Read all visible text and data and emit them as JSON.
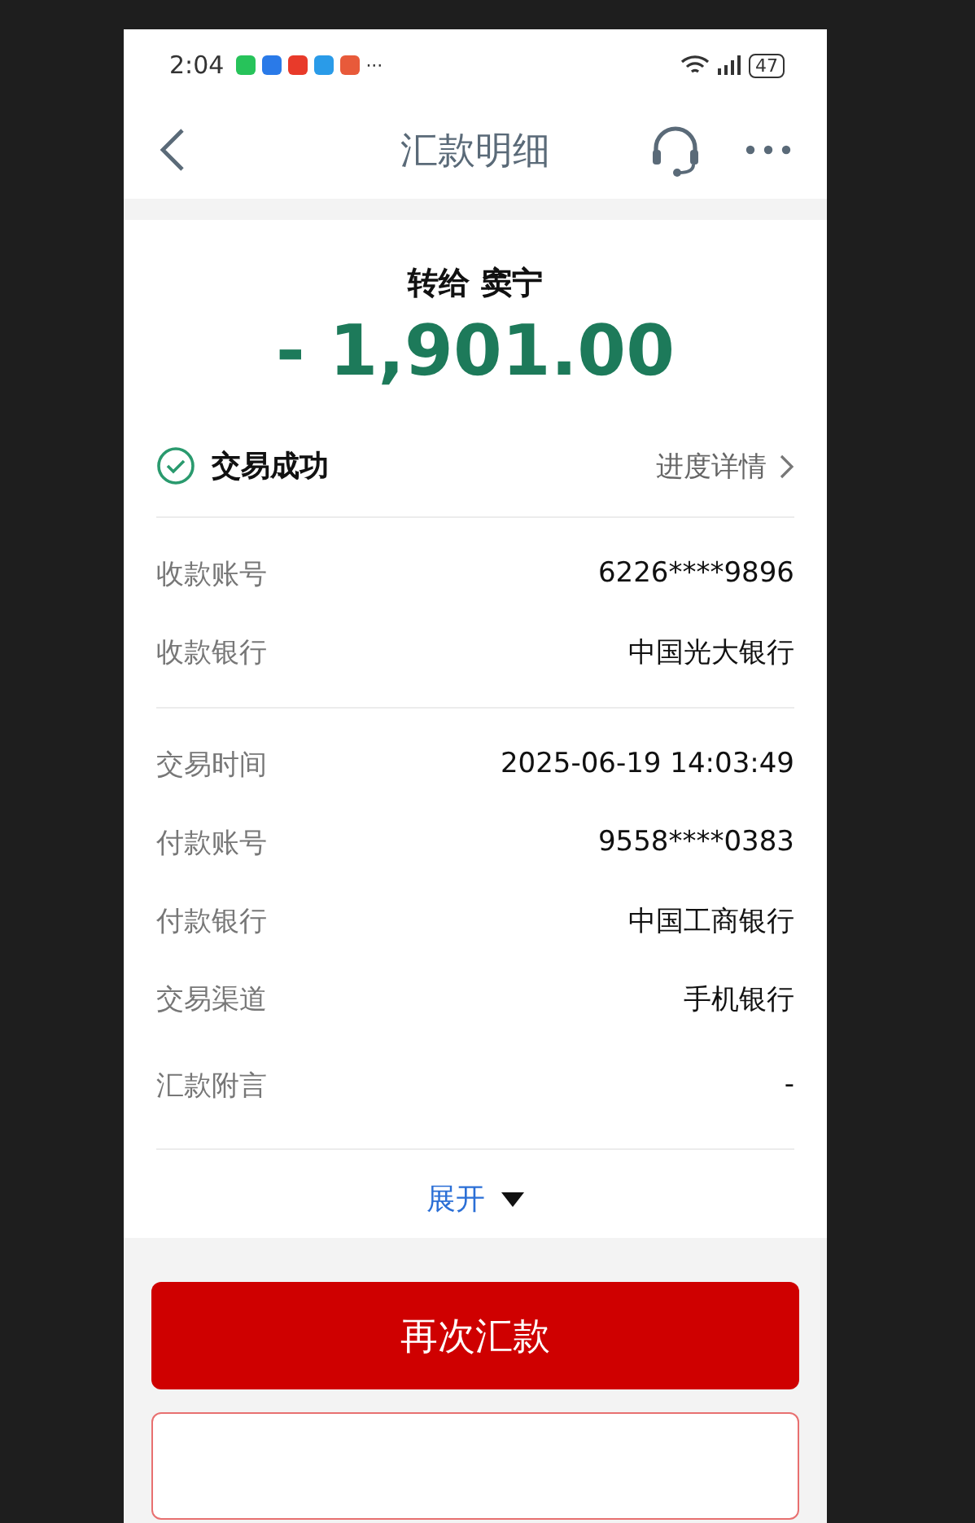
{
  "status_bar": {
    "time": "2:04",
    "more": "···",
    "battery": "47"
  },
  "header": {
    "title": "汇款明细"
  },
  "summary": {
    "recipient": "转给 窦宁",
    "amount": "- 1,901.00"
  },
  "status": {
    "label": "交易成功",
    "link": "进度详情"
  },
  "groups": [
    [
      {
        "label": "收款账号",
        "value": "6226****9896"
      },
      {
        "label": "收款银行",
        "value": "中国光大银行"
      }
    ],
    [
      {
        "label": "交易时间",
        "value": "2025-06-19 14:03:49"
      },
      {
        "label": "付款账号",
        "value": "9558****0383"
      },
      {
        "label": "付款银行",
        "value": "中国工商银行"
      },
      {
        "label": "交易渠道",
        "value": "手机银行"
      },
      {
        "label": "汇款附言",
        "value": "-"
      }
    ]
  ],
  "expand": {
    "label": "展开",
    "expanded": false
  },
  "buttons": [
    {
      "label": "再次汇款",
      "kind": "primary"
    },
    {
      "kind": "outline"
    }
  ]
}
